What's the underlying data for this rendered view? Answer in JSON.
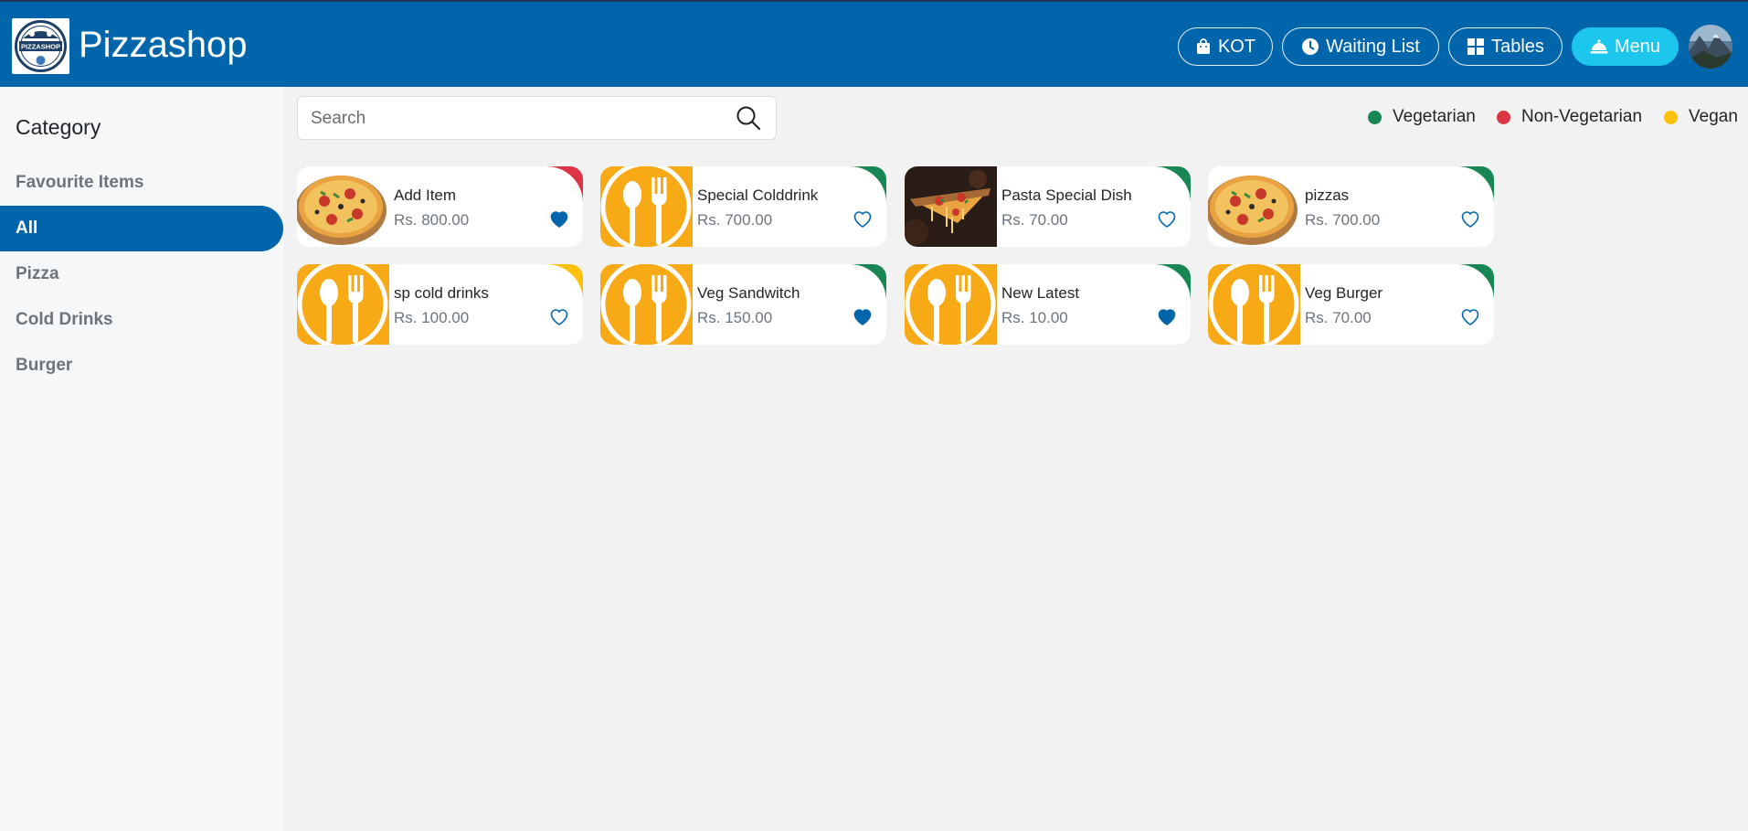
{
  "header": {
    "title": "Pizzashop",
    "logo_text": "PIZZASHOP",
    "buttons": [
      {
        "label": "KOT",
        "icon": "bag-icon",
        "active": false
      },
      {
        "label": "Waiting List",
        "icon": "clock-icon",
        "active": false
      },
      {
        "label": "Tables",
        "icon": "grid-icon",
        "active": false
      },
      {
        "label": "Menu",
        "icon": "cloche-icon",
        "active": true
      }
    ]
  },
  "sidebar": {
    "title": "Category",
    "items": [
      {
        "label": "Favourite Items",
        "active": false
      },
      {
        "label": "All",
        "active": true
      },
      {
        "label": "Pizza",
        "active": false
      },
      {
        "label": "Cold Drinks",
        "active": false
      },
      {
        "label": "Burger",
        "active": false
      }
    ]
  },
  "search": {
    "placeholder": "Search",
    "value": ""
  },
  "legend": [
    {
      "label": "Vegetarian",
      "color": "#198754"
    },
    {
      "label": "Non-Vegetarian",
      "color": "#dc3545"
    },
    {
      "label": "Vegan",
      "color": "#ffc107"
    }
  ],
  "items": [
    {
      "name": "Add Item",
      "price": "Rs. 800.00",
      "type": "non-veg",
      "image": "pizza",
      "favorite": true
    },
    {
      "name": "Special Colddrink",
      "price": "Rs. 700.00",
      "type": "veg",
      "image": "utensils",
      "favorite": false
    },
    {
      "name": "Pasta Special Dish",
      "price": "Rs. 70.00",
      "type": "veg",
      "image": "pizza-slice",
      "favorite": false
    },
    {
      "name": "pizzas",
      "price": "Rs. 700.00",
      "type": "veg",
      "image": "pizza",
      "favorite": false
    },
    {
      "name": "sp cold drinks",
      "price": "Rs. 100.00",
      "type": "vegan",
      "image": "utensils",
      "favorite": false
    },
    {
      "name": "Veg Sandwitch",
      "price": "Rs. 150.00",
      "type": "veg",
      "image": "utensils",
      "favorite": true
    },
    {
      "name": "New Latest",
      "price": "Rs. 10.00",
      "type": "veg",
      "image": "utensils",
      "favorite": true
    },
    {
      "name": "Veg Burger",
      "price": "Rs. 70.00",
      "type": "veg",
      "image": "utensils",
      "favorite": false
    }
  ],
  "colors": {
    "brand": "#0065ab",
    "active_button": "#1cc6ed",
    "veg": "#198754",
    "non-veg": "#dc3545",
    "vegan": "#ffc107",
    "utensil_bg": "#f8a916"
  }
}
